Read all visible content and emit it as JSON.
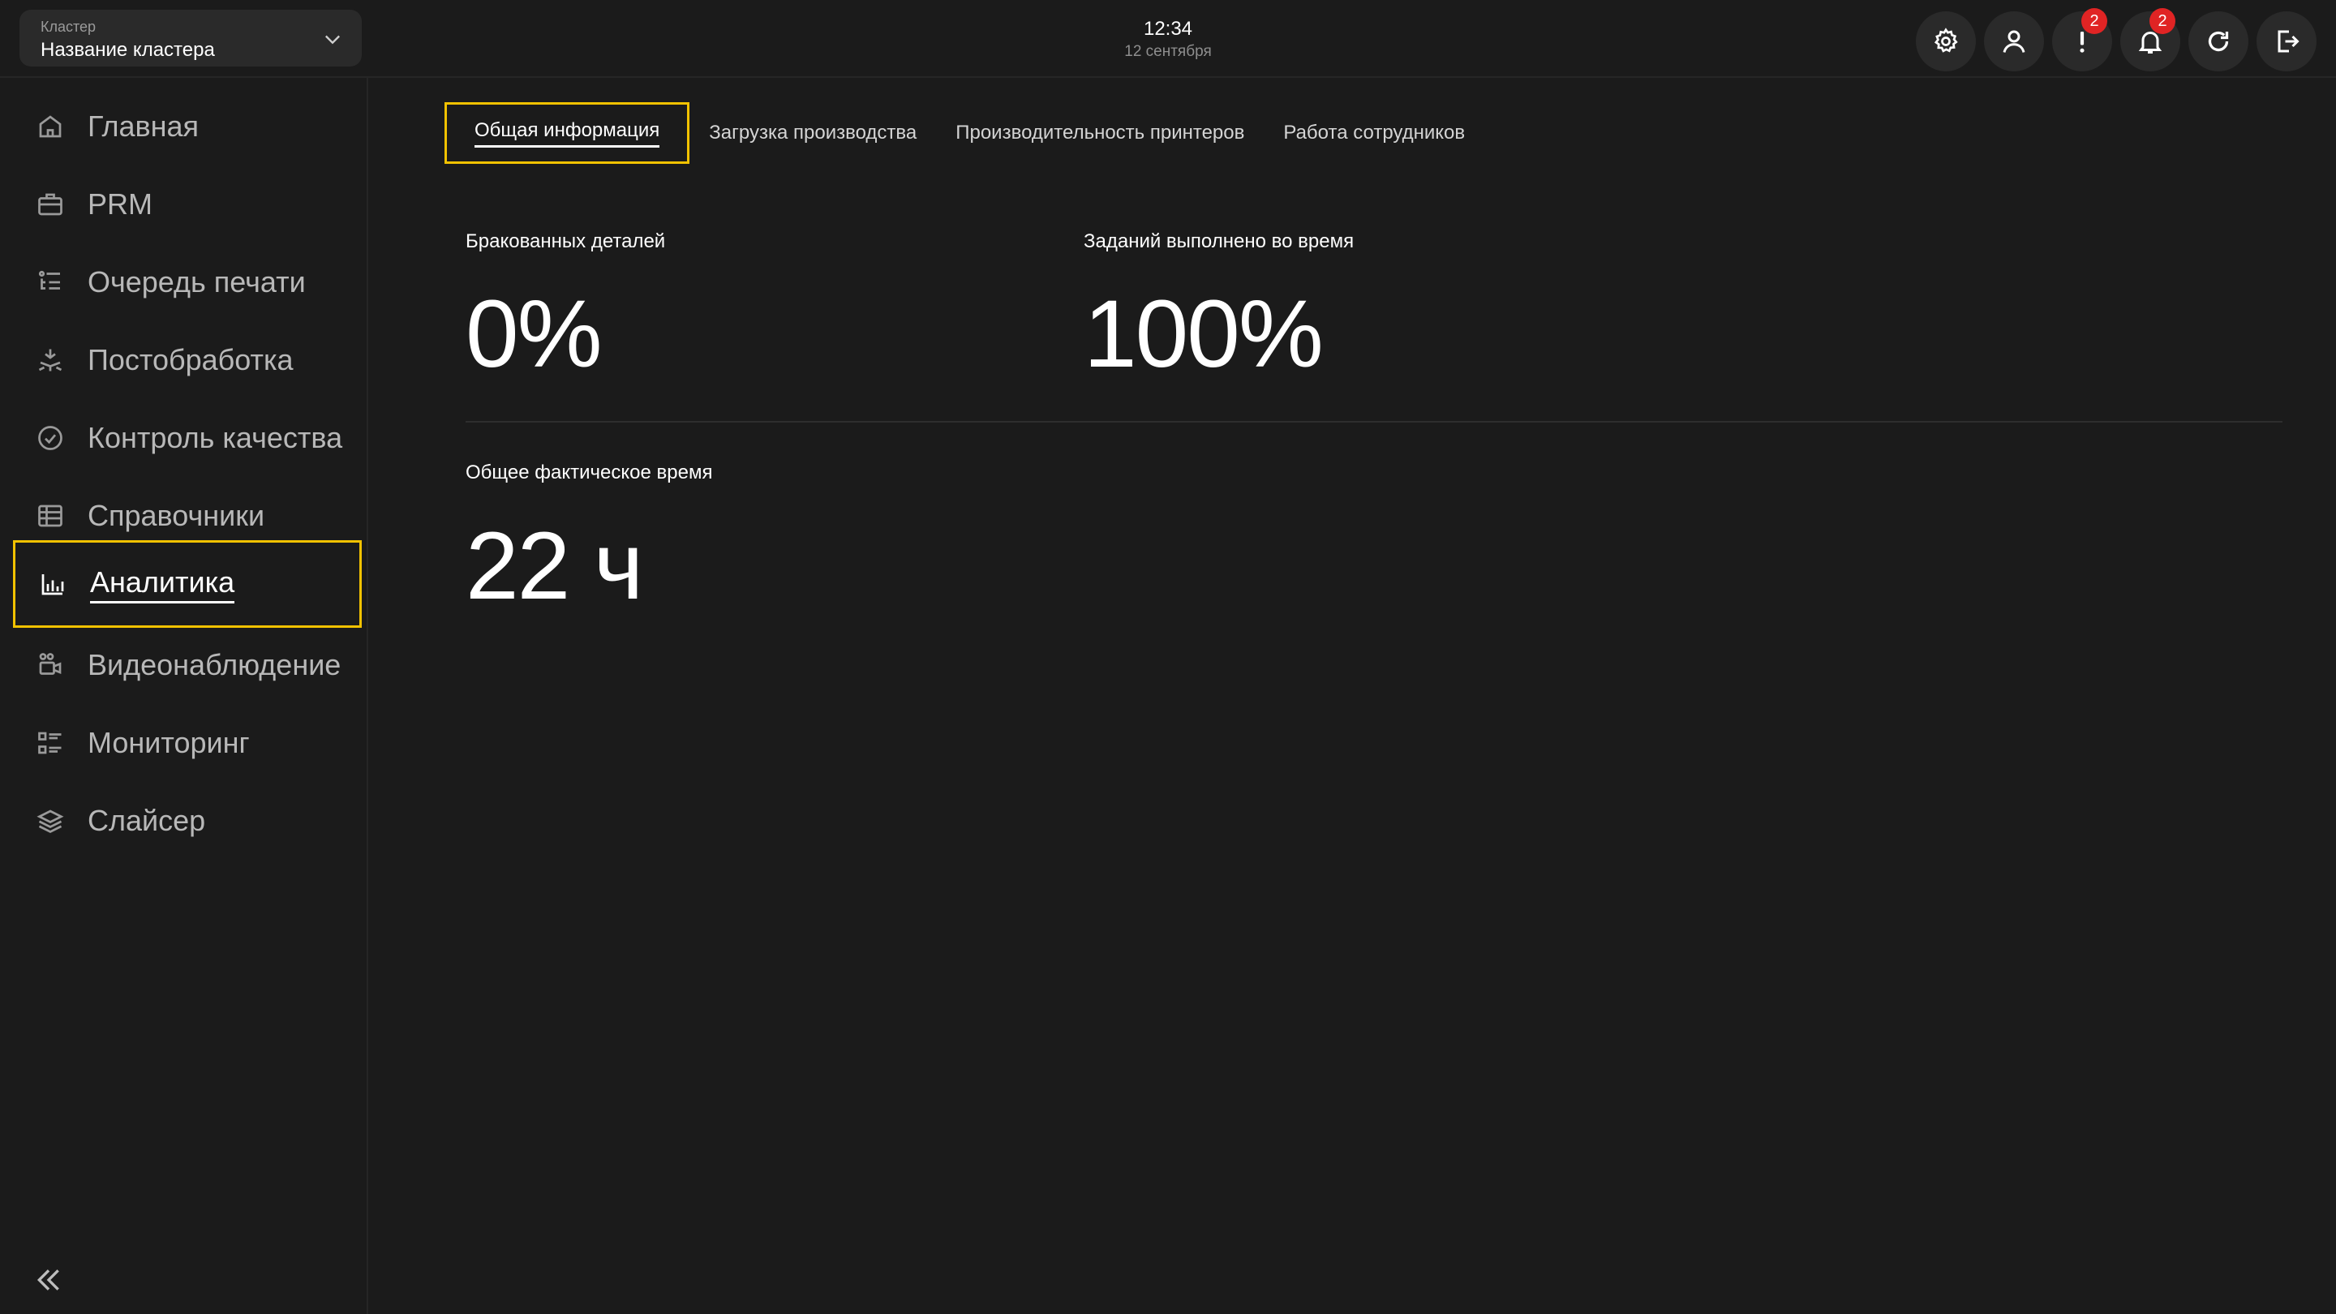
{
  "header": {
    "cluster_label": "Кластер",
    "cluster_name": "Название кластера",
    "time": "12:34",
    "date": "12 сентября",
    "alerts_count": "2",
    "notifications_count": "2",
    "accent_color": "#f2c200",
    "badge_color": "#e02424"
  },
  "sidebar": {
    "items": [
      {
        "label": "Главная",
        "icon": "home-icon"
      },
      {
        "label": "PRM",
        "icon": "briefcase-icon"
      },
      {
        "label": "Очередь печати",
        "icon": "queue-list-icon"
      },
      {
        "label": "Постобработка",
        "icon": "postprocessing-icon"
      },
      {
        "label": "Контроль качества",
        "icon": "check-circle-icon"
      },
      {
        "label": "Справочники",
        "icon": "table-icon"
      },
      {
        "label": "Аналитика",
        "icon": "bar-chart-icon"
      },
      {
        "label": "Видеонаблюдение",
        "icon": "camera-icon"
      },
      {
        "label": "Мониторинг",
        "icon": "checklist-icon"
      },
      {
        "label": "Слайсер",
        "icon": "layers-icon"
      }
    ],
    "active_index": 6
  },
  "main": {
    "tabs": [
      {
        "label": "Общая информация"
      },
      {
        "label": "Загрузка производства"
      },
      {
        "label": "Производительность принтеров"
      },
      {
        "label": "Работа сотрудников"
      }
    ],
    "metrics": [
      {
        "label": "Бракованных деталей",
        "value": "0%"
      },
      {
        "label": "Заданий выполнено во время",
        "value": "100%"
      },
      {
        "label": "Общее фактическое время",
        "value": "22 ч"
      }
    ]
  }
}
